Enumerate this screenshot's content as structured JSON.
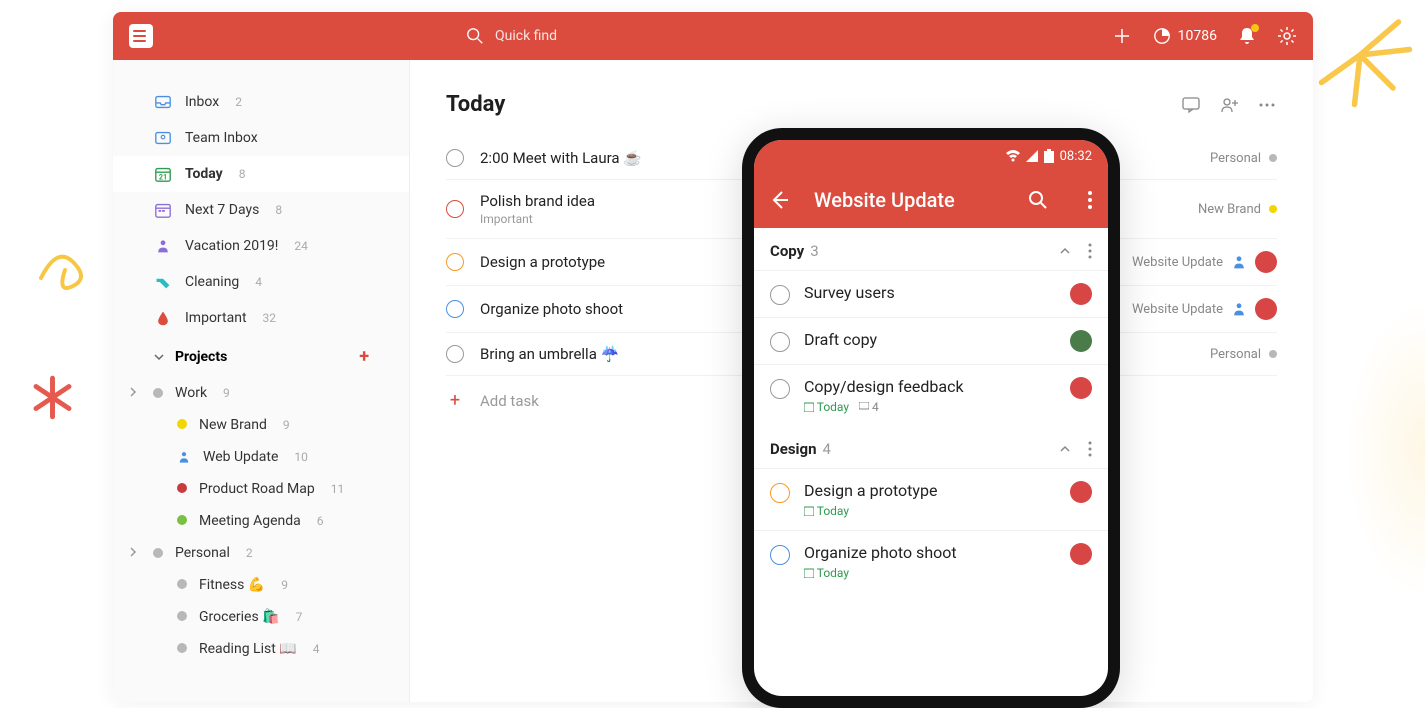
{
  "header": {
    "search_placeholder": "Quick find",
    "karma": "10786"
  },
  "sidebar": {
    "items": [
      {
        "label": "Inbox",
        "count": "2",
        "icon": "inbox"
      },
      {
        "label": "Team Inbox",
        "count": "",
        "icon": "team-inbox"
      },
      {
        "label": "Today",
        "count": "8",
        "icon": "today",
        "active": true
      },
      {
        "label": "Next 7 Days",
        "count": "8",
        "icon": "next7"
      },
      {
        "label": "Vacation 2019!",
        "count": "24",
        "icon": "person"
      },
      {
        "label": "Cleaning",
        "count": "4",
        "icon": "tag"
      },
      {
        "label": "Important",
        "count": "32",
        "icon": "drop"
      }
    ],
    "projects_label": "Projects",
    "projects": [
      {
        "label": "Work",
        "count": "9",
        "color": "#b8b8b8",
        "expandable": true,
        "children": [
          {
            "label": "New Brand",
            "count": "9",
            "color": "#f2d600"
          },
          {
            "label": "Web Update",
            "count": "10",
            "color": "#4a90e2",
            "icon": "person"
          },
          {
            "label": "Product Road Map",
            "count": "11",
            "color": "#c83c3c"
          },
          {
            "label": "Meeting Agenda",
            "count": "6",
            "color": "#7bc043"
          }
        ]
      },
      {
        "label": "Personal",
        "count": "2",
        "color": "#b8b8b8",
        "expandable": true,
        "children": [
          {
            "label": "Fitness 💪",
            "count": "9",
            "color": "#b8b8b8"
          },
          {
            "label": "Groceries 🛍️",
            "count": "7",
            "color": "#b8b8b8"
          },
          {
            "label": "Reading List 📖",
            "count": "4",
            "color": "#b8b8b8"
          }
        ]
      }
    ]
  },
  "main": {
    "title": "Today",
    "tasks": [
      {
        "title": "2:00 Meet with Laura ☕",
        "priority": "",
        "project": "Personal",
        "proj_color": "#b8b8b8"
      },
      {
        "title": "Polish brand idea",
        "sub": "Important",
        "priority": "p1",
        "project": "New Brand",
        "proj_color": "#f2d600"
      },
      {
        "title": "Design a prototype",
        "priority": "p2",
        "project": "Website Update",
        "proj_color": "",
        "assignee": true,
        "assignee_icon": true
      },
      {
        "title": "Organize photo shoot",
        "priority": "p3",
        "project": "Website Update",
        "proj_color": "",
        "assignee": true,
        "assignee_icon": true
      },
      {
        "title": "Bring an umbrella ☔",
        "priority": "",
        "project": "Personal",
        "proj_color": "#b8b8b8"
      }
    ],
    "add_task": "Add task"
  },
  "phone": {
    "time": "08:32",
    "title": "Website Update",
    "sections": [
      {
        "title": "Copy",
        "count": "3",
        "tasks": [
          {
            "title": "Survey users",
            "avatar": "a1"
          },
          {
            "title": "Draft copy",
            "avatar": "a2"
          },
          {
            "title": "Copy/design feedback",
            "due": "Today",
            "comments": "4",
            "avatar": "a1"
          }
        ]
      },
      {
        "title": "Design",
        "count": "4",
        "tasks": [
          {
            "title": "Design a prototype",
            "due": "Today",
            "priority": "p2",
            "avatar": "a1"
          },
          {
            "title": "Organize photo shoot",
            "due": "Today",
            "priority": "p3",
            "avatar": "a1"
          }
        ]
      }
    ]
  }
}
